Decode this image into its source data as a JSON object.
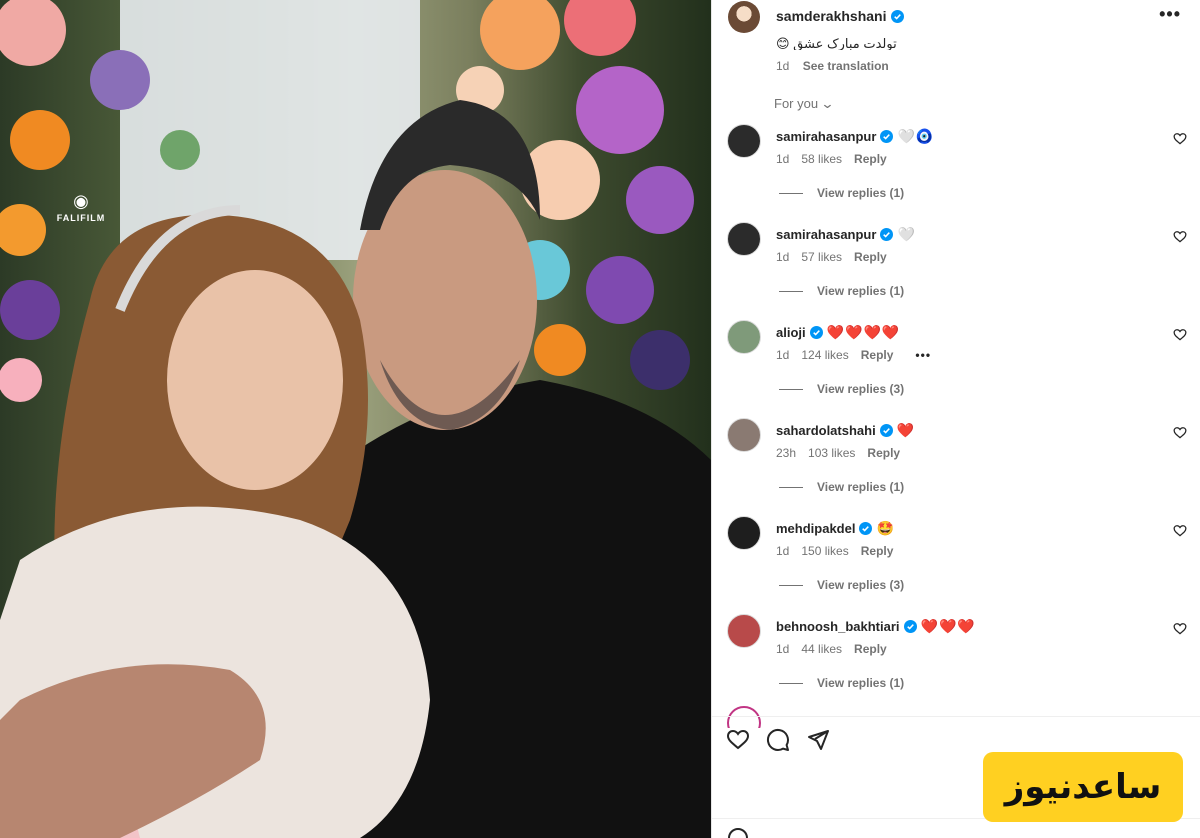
{
  "post": {
    "username": "samderakhshani",
    "caption": "تولدت مبارک عشق 😊",
    "time": "1d",
    "see_translation": "See translation",
    "watermark": "FALIFILM"
  },
  "comments_filter": {
    "label": "For you",
    "chevron": "chevron-down-icon"
  },
  "comments": [
    {
      "username": "samirahasanpur",
      "emoji": "🤍🧿",
      "time": "1d",
      "likes": "58 likes",
      "reply": "Reply",
      "view_replies": "View replies (1)",
      "avatar_color": "#2b2b2b"
    },
    {
      "username": "samirahasanpur",
      "emoji": "🤍",
      "time": "1d",
      "likes": "57 likes",
      "reply": "Reply",
      "view_replies": "View replies (1)",
      "avatar_color": "#2b2b2b"
    },
    {
      "username": "alioji",
      "emoji": "❤️❤️❤️❤️",
      "time": "1d",
      "likes": "124 likes",
      "reply": "Reply",
      "more": "•••",
      "view_replies": "View replies (3)",
      "avatar_color": "#7f9a7a"
    },
    {
      "username": "sahardolatshahi",
      "emoji": "❤️",
      "time": "23h",
      "likes": "103 likes",
      "reply": "Reply",
      "view_replies": "View replies (1)",
      "avatar_color": "#8a7a72"
    },
    {
      "username": "mehdipakdel",
      "emoji": "🤩",
      "time": "1d",
      "likes": "150 likes",
      "reply": "Reply",
      "view_replies": "View replies (3)",
      "avatar_color": "#1e1e1e"
    },
    {
      "username": "behnoosh_bakhtiari",
      "emoji": "❤️❤️❤️",
      "time": "1d",
      "likes": "44 likes",
      "reply": "Reply",
      "view_replies": "View replies (1)",
      "avatar_color": "#b84a4a"
    }
  ],
  "logo": {
    "text": "ساعدنیوز"
  },
  "colors": {
    "verified": "#0095f6",
    "heart": "#ed4956",
    "logo_bg": "#ffd021"
  }
}
